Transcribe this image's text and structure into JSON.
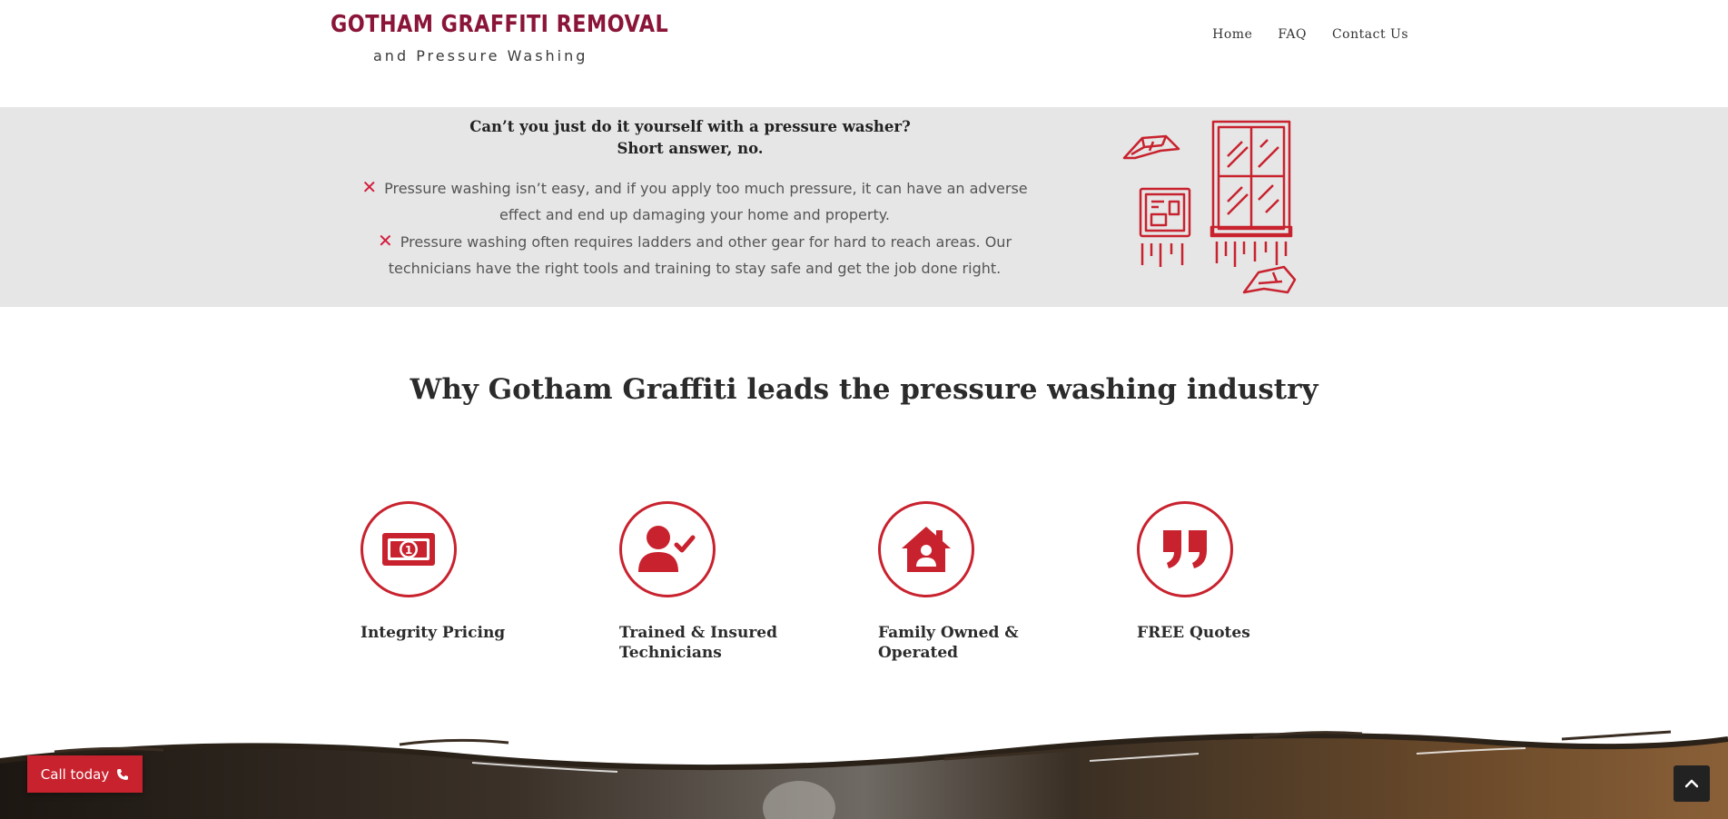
{
  "header": {
    "logo_line1": "GOTHAM GRAFFITI REMOVAL",
    "logo_line2": "and Pressure Washing",
    "nav": [
      {
        "label": "Home"
      },
      {
        "label": "FAQ"
      },
      {
        "label": "Contact Us"
      }
    ]
  },
  "band": {
    "question": "Can’t you just do it yourself with a pressure washer?",
    "answer": "Short answer, no.",
    "items": [
      {
        "text": "Pressure washing isn’t easy, and if you apply too much pressure, it can have an adverse effect and end up damaging your home and property."
      },
      {
        "text": "Pressure washing often requires ladders and other gear for hard to reach areas. Our technicians have the right tools and training to stay safe and get the job done right."
      }
    ]
  },
  "why": {
    "title": "Why Gotham Graffiti leads the pressure washing industry",
    "features": [
      {
        "label": "Integrity Pricing",
        "icon": "money-bill-icon"
      },
      {
        "label": "Trained & Insured Technicians",
        "icon": "user-check-icon"
      },
      {
        "label": "Family Owned & Operated",
        "icon": "house-user-icon"
      },
      {
        "label": "FREE Quotes",
        "icon": "quote-icon"
      }
    ]
  },
  "cta": {
    "call_label": "Call today"
  },
  "colors": {
    "accent": "#c8222e",
    "brand": "#8a1538",
    "band_bg": "#e6e6e6"
  }
}
